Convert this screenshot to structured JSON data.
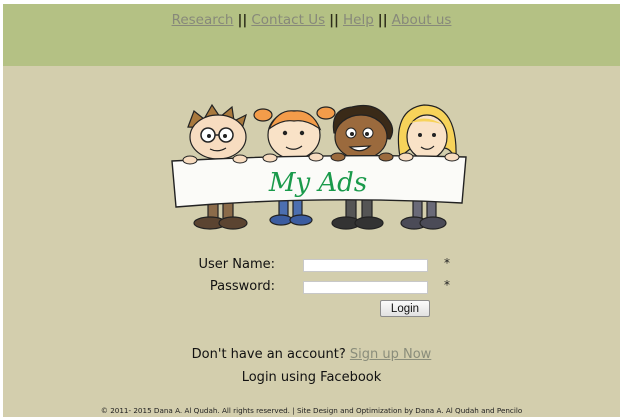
{
  "nav": {
    "links": [
      "Research",
      "Contact Us",
      "Help",
      "About us"
    ],
    "separator": "||"
  },
  "logo": {
    "banner_text": "My Ads"
  },
  "form": {
    "username_label": "User Name:",
    "password_label": "Password:",
    "required_marker": "*",
    "username_value": "",
    "password_value": "",
    "login_button": "Login"
  },
  "signup": {
    "prompt": "Don't have an account?",
    "link": "Sign up Now"
  },
  "facebook_login": "Login using Facebook",
  "footer": "© 2011- 2015 Dana A. Al Qudah. All rights reserved. | Site Design and Optimization by Dana A. Al Qudah and Pencilo",
  "colors": {
    "page_background": "#d3cead",
    "header_band": "#b4c184",
    "link": "#87897a"
  }
}
